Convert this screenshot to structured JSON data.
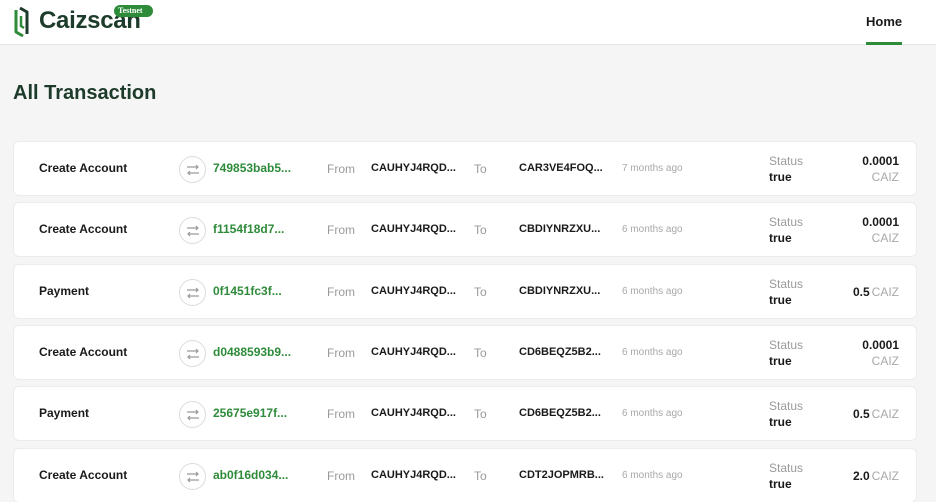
{
  "header": {
    "brand": "Caizscan",
    "badge": "Testnet",
    "nav": {
      "home_label": "Home"
    },
    "accent": "#2e8b3a"
  },
  "page": {
    "title": "All Transaction"
  },
  "labels": {
    "from": "From",
    "to": "To",
    "status": "Status"
  },
  "icons": {
    "logo": "caizscan-logo-icon",
    "transaction": "swap-arrows-icon"
  },
  "transactions": [
    {
      "type": "Create Account",
      "hash": "749853bab5...",
      "from": "CAUHYJ4RQD...",
      "to": "CAR3VE4FOQ...",
      "age": "7 months ago",
      "status": "true",
      "amount": "0.0001",
      "unit": "CAIZ"
    },
    {
      "type": "Create Account",
      "hash": "f1154f18d7...",
      "from": "CAUHYJ4RQD...",
      "to": "CBDIYNRZXU...",
      "age": "6 months ago",
      "status": "true",
      "amount": "0.0001",
      "unit": "CAIZ"
    },
    {
      "type": "Payment",
      "hash": "0f1451fc3f...",
      "from": "CAUHYJ4RQD...",
      "to": "CBDIYNRZXU...",
      "age": "6 months ago",
      "status": "true",
      "amount": "0.5",
      "unit": "CAIZ"
    },
    {
      "type": "Create Account",
      "hash": "d0488593b9...",
      "from": "CAUHYJ4RQD...",
      "to": "CD6BEQZ5B2...",
      "age": "6 months ago",
      "status": "true",
      "amount": "0.0001",
      "unit": "CAIZ"
    },
    {
      "type": "Payment",
      "hash": "25675e917f...",
      "from": "CAUHYJ4RQD...",
      "to": "CD6BEQZ5B2...",
      "age": "6 months ago",
      "status": "true",
      "amount": "0.5",
      "unit": "CAIZ"
    },
    {
      "type": "Create Account",
      "hash": "ab0f16d034...",
      "from": "CAUHYJ4RQD...",
      "to": "CDT2JOPMRB...",
      "age": "6 months ago",
      "status": "true",
      "amount": "2.0",
      "unit": "CAIZ"
    }
  ]
}
